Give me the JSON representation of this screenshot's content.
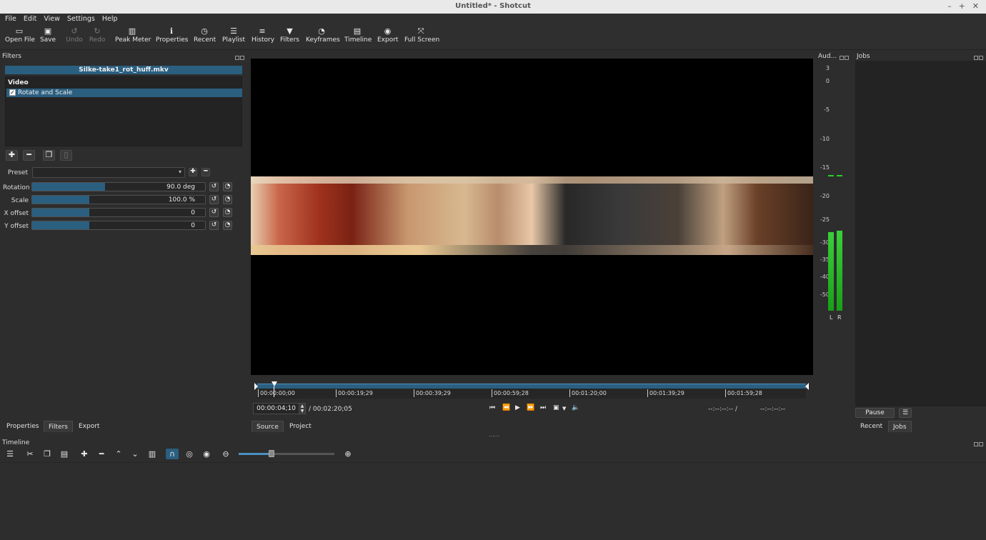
{
  "window": {
    "title": "Untitled* - Shotcut",
    "min": "–",
    "max": "+",
    "close": "✕"
  },
  "menu": [
    "File",
    "Edit",
    "View",
    "Settings",
    "Help"
  ],
  "toolbar": {
    "open_file": "Open File",
    "save": "Save",
    "undo": "Undo",
    "redo": "Redo",
    "peak_meter": "Peak Meter",
    "properties": "Properties",
    "recent": "Recent",
    "playlist": "Playlist",
    "history": "History",
    "filters": "Filters",
    "keyframes": "Keyframes",
    "timeline": "Timeline",
    "export": "Export",
    "full_screen": "Full Screen"
  },
  "filters_panel": {
    "title": "Filters",
    "clip_name": "Silke-take1_rot_huff.mkv",
    "category": "Video",
    "filter_item": "Rotate and Scale",
    "filter_checked": "✓",
    "preset_label": "Preset",
    "preset_value": "",
    "params": {
      "rotation_label": "Rotation",
      "rotation_value": "90.0",
      "rotation_unit": " deg",
      "rotation_fraction": 0.42,
      "scale_label": "Scale",
      "scale_value": "100.0 %",
      "scale_fraction": 0.33,
      "xoffset_label": "X offset",
      "xoffset_value": "0",
      "xoffset_fraction": 0.33,
      "yoffset_label": "Y offset",
      "yoffset_value": "0",
      "yoffset_fraction": 0.33
    }
  },
  "left_tabs": [
    "Properties",
    "Filters",
    "Export"
  ],
  "player": {
    "timecode": "00:00:04;10",
    "duration": "/ 00:02:20;05",
    "in_point": "--:--:--:-- /",
    "out_point": "--:--:--:--",
    "ticks": [
      "00:00:00;00",
      "00:00:19;29",
      "00:00:39;29",
      "00:00:59;28",
      "00:01:20;00",
      "00:01:39;29",
      "00:01:59;28"
    ],
    "tabs": [
      "Source",
      "Project"
    ],
    "splitter": "......"
  },
  "audio_meter": {
    "title": "Aud...",
    "scale": [
      "3",
      "0",
      "-5",
      "-10",
      "-15",
      "-20",
      "-25",
      "-30",
      "-35",
      "-40",
      "-50"
    ],
    "left_label": "L",
    "right_label": "R",
    "left_level_db": -29,
    "right_level_db": -28.5,
    "peak_db": -16
  },
  "jobs_panel": {
    "title": "Jobs",
    "pause": "Pause",
    "menu": "☰",
    "tabs": [
      "Recent",
      "Jobs"
    ]
  },
  "timeline": {
    "title": "Timeline"
  },
  "colors": {
    "accent": "#2b5f80",
    "highlight": "#4a90c0",
    "meter": "#28c028",
    "background": "#2d2d2d"
  }
}
